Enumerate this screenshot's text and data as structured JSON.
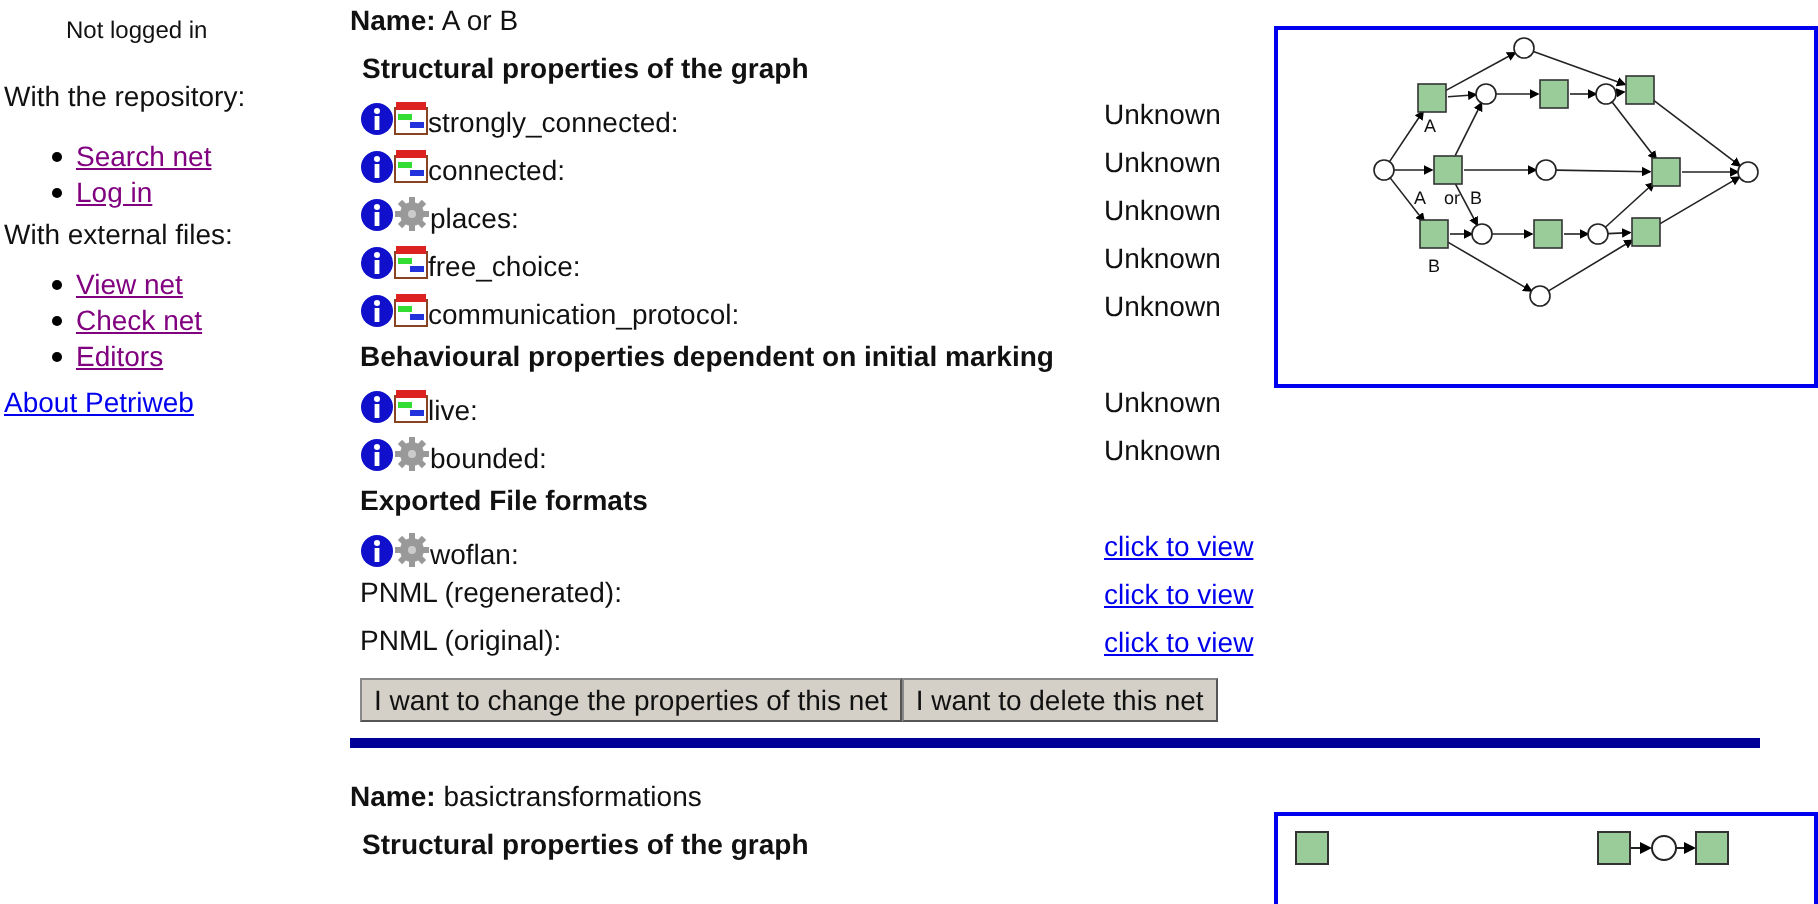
{
  "sidebar": {
    "status": "Not logged in",
    "sections": [
      {
        "title": "With the repository:",
        "links": [
          {
            "label": "Search net",
            "visited": true
          },
          {
            "label": "Log in",
            "visited": true
          }
        ]
      },
      {
        "title": "With external files:",
        "links": [
          {
            "label": "View net",
            "visited": true
          },
          {
            "label": "Check net",
            "visited": true
          },
          {
            "label": "Editors",
            "visited": true
          }
        ]
      }
    ],
    "about_link": {
      "label": "About Petriweb",
      "visited": false
    }
  },
  "nets": [
    {
      "name_label": "Name:",
      "name": "A or B",
      "diagram": {
        "kind": "branching",
        "labels": [
          "A",
          "A",
          "or",
          "B",
          "B"
        ]
      },
      "groups": [
        {
          "title": "Structural properties of the graph",
          "rows": [
            {
              "label": "strongly_connected:",
              "icons": [
                {
                  "kind": "info"
                },
                {
                  "kind": "chart"
                }
              ],
              "value": "Unknown",
              "kind": "text"
            },
            {
              "label": "connected:",
              "icons": [
                {
                  "kind": "info"
                },
                {
                  "kind": "chart"
                }
              ],
              "value": "Unknown",
              "kind": "text"
            },
            {
              "label": "places:",
              "icons": [
                {
                  "kind": "info"
                },
                {
                  "kind": "gear"
                }
              ],
              "value": "Unknown",
              "kind": "text"
            },
            {
              "label": "free_choice:",
              "icons": [
                {
                  "kind": "info"
                },
                {
                  "kind": "chart"
                }
              ],
              "value": "Unknown",
              "kind": "text"
            },
            {
              "label": "communication_protocol:",
              "icons": [
                {
                  "kind": "info"
                },
                {
                  "kind": "chart"
                }
              ],
              "value": "Unknown",
              "kind": "text"
            }
          ]
        },
        {
          "title": "Behavioural properties dependent on initial marking",
          "rows": [
            {
              "label": "live:",
              "icons": [
                {
                  "kind": "info"
                },
                {
                  "kind": "chart"
                }
              ],
              "value": "Unknown",
              "kind": "text"
            },
            {
              "label": "bounded:",
              "icons": [
                {
                  "kind": "info"
                },
                {
                  "kind": "gear"
                }
              ],
              "value": "Unknown",
              "kind": "text"
            }
          ]
        },
        {
          "title": "Exported File formats",
          "rows": [
            {
              "label": "woflan:",
              "icons": [
                {
                  "kind": "info"
                },
                {
                  "kind": "gear"
                }
              ],
              "value": "click to view",
              "kind": "link"
            },
            {
              "label": "PNML (regenerated):",
              "value": "click to view",
              "kind": "link"
            },
            {
              "label": "PNML (original):",
              "value": "click to view",
              "kind": "link"
            }
          ]
        }
      ],
      "buttons": [
        "I want to change the properties of this net",
        "I want to delete this net"
      ]
    },
    {
      "name_label": "Name:",
      "name": "basictransformations",
      "diagram": {
        "kind": "chain"
      },
      "groups": [
        {
          "title": "Structural properties of the graph"
        }
      ]
    }
  ]
}
